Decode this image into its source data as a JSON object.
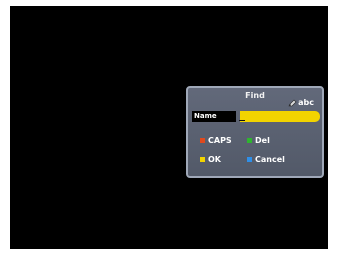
{
  "dialog": {
    "title": "Find",
    "mode_label": "abc",
    "mode_icon": "pencil-icon",
    "name_label": "Name",
    "name_value": ""
  },
  "keys": [
    {
      "label": "CAPS",
      "color": "#e04a1e",
      "icon": "red-key-icon"
    },
    {
      "label": "Del",
      "color": "#2fb52f",
      "icon": "green-key-icon"
    },
    {
      "label": "OK",
      "color": "#f2d400",
      "icon": "yellow-key-icon"
    },
    {
      "label": "Cancel",
      "color": "#2f8fe8",
      "icon": "blue-key-icon"
    }
  ],
  "colors": {
    "screen": "#000000",
    "dialog_bg": "#5b6272",
    "input_bg": "#f2d400"
  }
}
